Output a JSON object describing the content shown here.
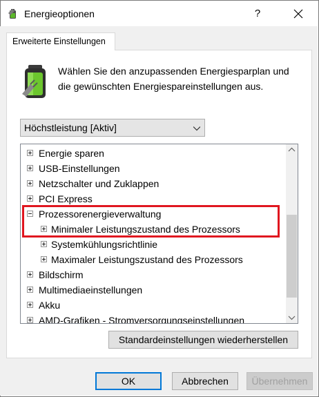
{
  "window": {
    "title": "Energieoptionen",
    "help_label": "?",
    "close_label": "✕"
  },
  "tab": {
    "label": "Erweiterte Einstellungen"
  },
  "description": "Wählen Sie den anzupassenden Energiesparplan und die gewünschten Energiespareinstellungen aus.",
  "plan_select": {
    "value": "Höchstleistung [Aktiv]"
  },
  "tree": {
    "items": [
      {
        "label": "Energie sparen",
        "expanded": false,
        "level": 0
      },
      {
        "label": "USB-Einstellungen",
        "expanded": false,
        "level": 0
      },
      {
        "label": "Netzschalter und Zuklappen",
        "expanded": false,
        "level": 0
      },
      {
        "label": "PCI Express",
        "expanded": false,
        "level": 0
      },
      {
        "label": "Prozessorenergieverwaltung",
        "expanded": true,
        "level": 0
      },
      {
        "label": "Minimaler Leistungszustand des Prozessors",
        "expanded": false,
        "level": 1
      },
      {
        "label": "Systemkühlungsrichtlinie",
        "expanded": false,
        "level": 1
      },
      {
        "label": "Maximaler Leistungszustand des Prozessors",
        "expanded": false,
        "level": 1
      },
      {
        "label": "Bildschirm",
        "expanded": false,
        "level": 0
      },
      {
        "label": "Multimediaeinstellungen",
        "expanded": false,
        "level": 0
      },
      {
        "label": "Akku",
        "expanded": false,
        "level": 0
      },
      {
        "label": "AMD-Grafiken - Stromversorgungseinstellungen",
        "expanded": false,
        "level": 0
      }
    ]
  },
  "buttons": {
    "restore": "Standardeinstellungen wiederherstellen",
    "ok": "OK",
    "cancel": "Abbrechen",
    "apply": "Übernehmen"
  },
  "colors": {
    "highlight": "#e0161f",
    "focus": "#0078d7"
  }
}
